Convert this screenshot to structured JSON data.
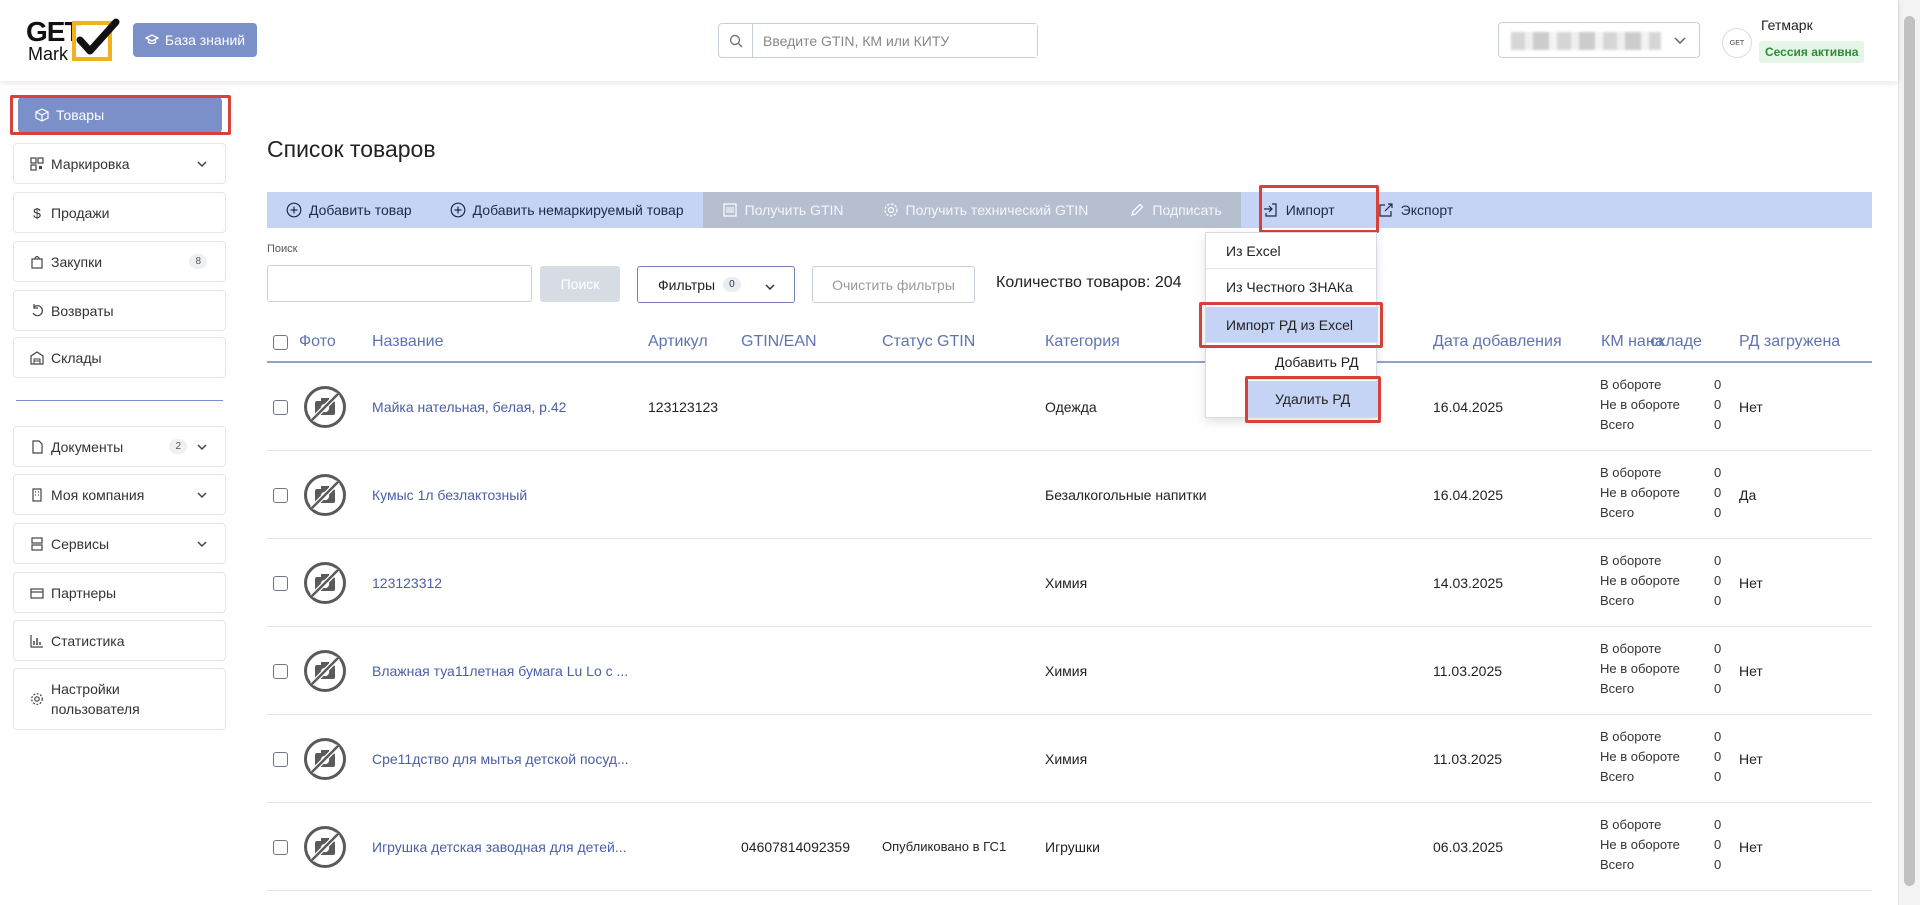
{
  "header": {
    "logo_top": "GET",
    "logo_bottom": "Mark",
    "kb_label": "База знаний",
    "search_placeholder": "Введите GTIN, КМ или КИТУ",
    "user_name": "Гетмарк",
    "session": "Сессия активна",
    "avatar_text": "GET"
  },
  "sidebar": {
    "items": [
      {
        "label": "Товары"
      },
      {
        "label": "Маркировка"
      },
      {
        "label": "Продажи"
      },
      {
        "label": "Закупки",
        "badge": "8"
      },
      {
        "label": "Возвраты"
      },
      {
        "label": "Склады"
      },
      {
        "label": "Документы",
        "badge": "2"
      },
      {
        "label": "Моя компания"
      },
      {
        "label": "Сервисы"
      },
      {
        "label": "Партнеры"
      },
      {
        "label": "Статистика"
      },
      {
        "label": "Настройки пользователя"
      }
    ]
  },
  "main": {
    "title": "Список товаров",
    "toolbar": {
      "add": "Добавить товар",
      "add_unmarked": "Добавить немаркируемый товар",
      "get_gtin": "Получить GTIN",
      "get_tech_gtin": "Получить технический GTIN",
      "sign": "Подписать",
      "import": "Импорт",
      "export": "Экспорт"
    },
    "search_label": "Поиск",
    "search_button": "Поиск",
    "filters_label": "Фильтры",
    "filters_count": "0",
    "clear_filters": "Очистить фильтры",
    "count_text": "Количество товаров: 204",
    "import_menu": [
      "Из Excel",
      "Из Честного ЗНАКа",
      "Импорт РД из Excel",
      "Добавить РД",
      "Удалить РД"
    ],
    "columns": {
      "photo": "Фото",
      "name": "Название",
      "article": "Артикул",
      "gtin": "GTIN/EAN",
      "gtin_status": "Статус GTIN",
      "category": "Категория",
      "price_partial": "на",
      "date_added": "Дата добавления",
      "km_stock": "КМ на складе",
      "rd_loaded": "РД загружена"
    },
    "km_labels": [
      "В обороте",
      "Не в обороте",
      "Всего"
    ],
    "rows": [
      {
        "name": "Майка нательная, белая, р.42",
        "article": "123123123",
        "gtin": "",
        "status": "",
        "category": "Одежда",
        "date": "16.04.2025",
        "km": [
          "0",
          "0",
          "0"
        ],
        "rd": "Нет"
      },
      {
        "name": "Кумыс 1л безлактозный",
        "article": "",
        "gtin": "",
        "status": "",
        "category": "Безалкогольные напитки",
        "date": "16.04.2025",
        "km": [
          "0",
          "0",
          "0"
        ],
        "rd": "Да"
      },
      {
        "name": "123123312",
        "article": "",
        "gtin": "",
        "status": "",
        "category": "Химия",
        "date": "14.03.2025",
        "km": [
          "0",
          "0",
          "0"
        ],
        "rd": "Нет"
      },
      {
        "name": "Влажная туа11летная бумага Lu Lo с ...",
        "article": "",
        "gtin": "",
        "status": "",
        "category": "Химия",
        "date": "11.03.2025",
        "km": [
          "0",
          "0",
          "0"
        ],
        "rd": "Нет"
      },
      {
        "name": "Сре11дство для мытья детской посуд...",
        "article": "",
        "gtin": "",
        "status": "",
        "category": "Химия",
        "date": "11.03.2025",
        "km": [
          "0",
          "0",
          "0"
        ],
        "rd": "Нет"
      },
      {
        "name": "Игрушка детская заводная для детей...",
        "article": "",
        "gtin": "04607814092359",
        "status": "Опубликовано в ГС1",
        "category": "Игрушки",
        "date": "06.03.2025",
        "km": [
          "0",
          "0",
          "0"
        ],
        "rd": "Нет"
      }
    ]
  },
  "colors": {
    "accent": "#7b8fc9",
    "toolbar_bg": "#c5d3f4",
    "highlight": "#d6413a",
    "link": "#4a5fa6"
  }
}
